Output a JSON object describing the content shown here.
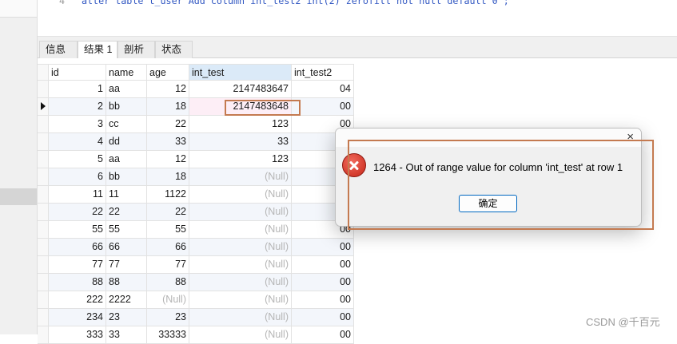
{
  "editor": {
    "line_number": "4",
    "code": "alter table t_user Add column int_test2 int(2) zerofill not null default 0 ;"
  },
  "tabs": [
    {
      "label": "信息"
    },
    {
      "label": "结果 1"
    },
    {
      "label": "剖析"
    },
    {
      "label": "状态"
    }
  ],
  "active_tab": 1,
  "grid": {
    "columns": [
      "id",
      "name",
      "age",
      "int_test",
      "int_test2"
    ],
    "rows": [
      [
        "1",
        "aa",
        "12",
        "2147483647",
        "04"
      ],
      [
        "2",
        "bb",
        "18",
        "2147483648",
        "00"
      ],
      [
        "3",
        "cc",
        "22",
        "123",
        "00"
      ],
      [
        "4",
        "dd",
        "33",
        "33",
        ""
      ],
      [
        "5",
        "aa",
        "12",
        "123",
        ""
      ],
      [
        "6",
        "bb",
        "18",
        "(Null)",
        ""
      ],
      [
        "11",
        "11",
        "1122",
        "(Null)",
        ""
      ],
      [
        "22",
        "22",
        "22",
        "(Null)",
        ""
      ],
      [
        "55",
        "55",
        "55",
        "(Null)",
        "00"
      ],
      [
        "66",
        "66",
        "66",
        "(Null)",
        "00"
      ],
      [
        "77",
        "77",
        "77",
        "(Null)",
        "00"
      ],
      [
        "88",
        "88",
        "88",
        "(Null)",
        "00"
      ],
      [
        "222",
        "2222",
        "(Null)",
        "(Null)",
        "00"
      ],
      [
        "234",
        "23",
        "23",
        "(Null)",
        "00"
      ],
      [
        "333",
        "33",
        "33333",
        "(Null)",
        "00"
      ]
    ],
    "current_row": 1
  },
  "dialog": {
    "close_glyph": "×",
    "message": "1264 - Out of range value for column 'int_test' at row 1",
    "ok_label": "确定"
  },
  "watermark": "CSDN @千百元",
  "icons": {
    "error": "error-icon",
    "close": "close-icon",
    "row_pointer": "row-pointer-icon"
  },
  "colors": {
    "accent": "#0067c0",
    "error": "#d33a2c",
    "annotation": "#c47a50",
    "header_highlight": "#dbeaf8",
    "modified_cell": "#fdeef6",
    "null_text": "#b5b5b5"
  }
}
